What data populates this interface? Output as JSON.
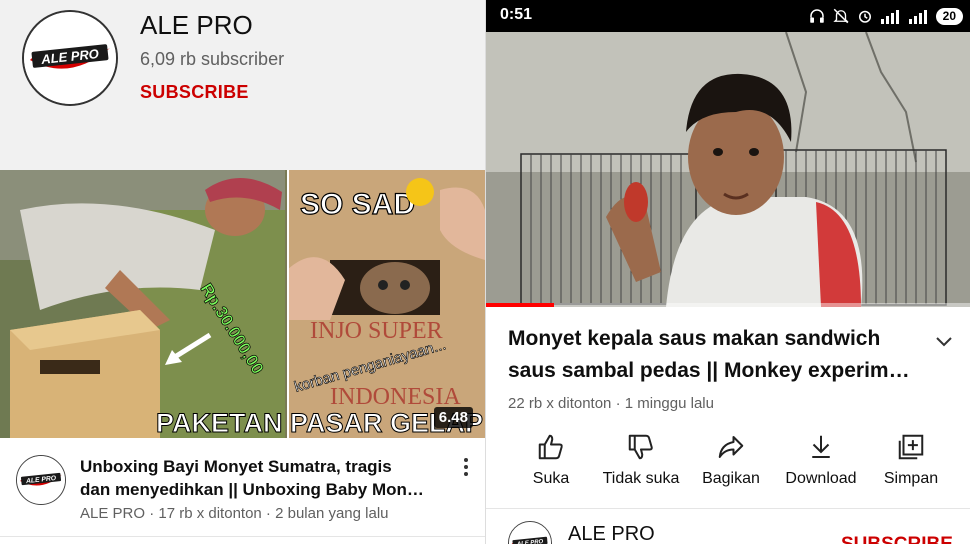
{
  "left": {
    "channel": {
      "name": "ALE PRO",
      "subscribers": "6,09 rb subscriber",
      "subscribe_label": "SUBSCRIBE",
      "logo_text": "ALE PRO"
    },
    "video": {
      "thumbnail_left_caption": "PAKETAN PASAR GELAP",
      "thumbnail_price": "Rp.30.000,00",
      "thumbnail_so_sad": "SO SAD",
      "thumbnail_box_text": "INJO SUPER",
      "thumbnail_box_text2": "INDONESIA",
      "thumbnail_korban": "korban penganiayaan...",
      "duration": "6.48",
      "title_line1": "Unboxing Bayi Monyet Sumatra, tragis",
      "title_line2": "dan menyedihkan || Unboxing Baby Mon…",
      "meta": "ALE PRO · 17 rb x ditonton · 2 bulan yang lalu"
    }
  },
  "right": {
    "status_bar": {
      "time": "0:51",
      "battery": "20"
    },
    "player": {
      "progress": 0.14
    },
    "video": {
      "title_line1": "Monyet kepala saus makan sandwich",
      "title_line2": "saus sambal pedas || Monkey experim…",
      "meta": "22 rb x ditonton · 1 minggu lalu"
    },
    "actions": [
      {
        "label": "Suka",
        "icon": "thumbs-up-icon"
      },
      {
        "label": "Tidak suka",
        "icon": "thumbs-down-icon"
      },
      {
        "label": "Bagikan",
        "icon": "share-icon"
      },
      {
        "label": "Download",
        "icon": "download-icon"
      },
      {
        "label": "Simpan",
        "icon": "save-playlist-icon"
      }
    ],
    "channel": {
      "name": "ALE PRO",
      "subscribe_label": "SUBSCRIBE"
    }
  },
  "colors": {
    "subscribe_red": "#cc0000",
    "progress_red": "#ff0000",
    "header_gray": "#f1f1f1"
  }
}
